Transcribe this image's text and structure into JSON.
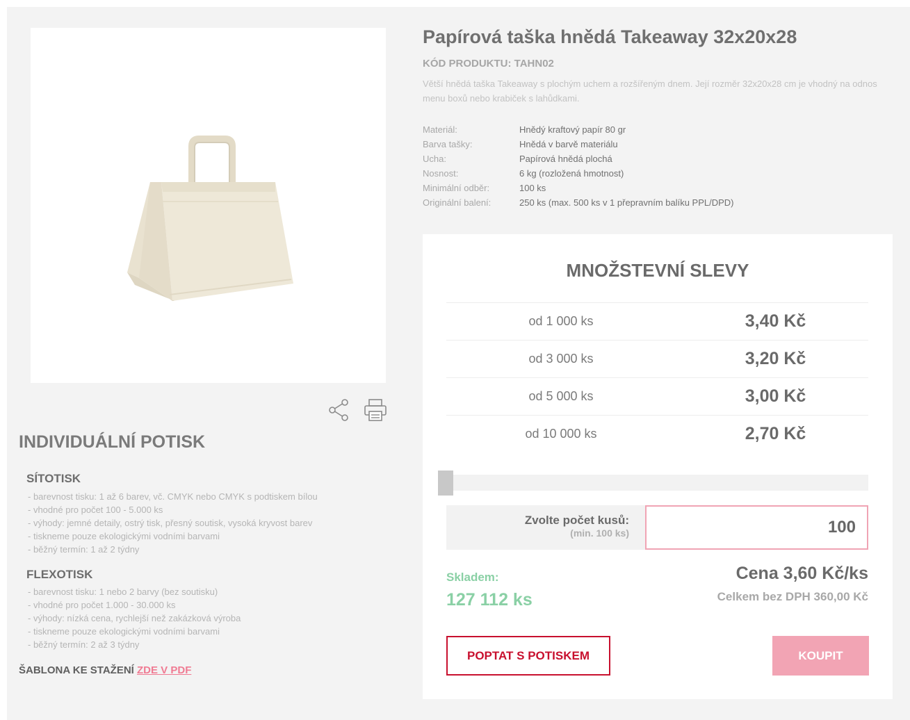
{
  "product": {
    "title": "Papírová taška hnědá Takeaway 32x20x28",
    "code": "KÓD PRODUKTU: TAHN02",
    "description": "Větší hnědá taška Takeaway s plochým uchem a rozšířeným dnem. Její rozměr 32x20x28 cm je vhodný na odnos menu boxů nebo krabiček s lahůdkami.",
    "specs": [
      {
        "label": "Materiál:",
        "value": "Hnědý kraftový papír 80 gr"
      },
      {
        "label": "Barva tašky:",
        "value": "Hnědá v barvě materiálu"
      },
      {
        "label": "Ucha:",
        "value": "Papírová hnědá plochá"
      },
      {
        "label": "Nosnost:",
        "value": "6 kg (rozložená hmotnost)"
      },
      {
        "label": "Minimální odběr:",
        "value": "100 ks"
      },
      {
        "label": "Originální balení:",
        "value": "250 ks (max. 500 ks v 1 přepravním balíku PPL/DPD)"
      }
    ]
  },
  "tools": {
    "share_icon": "share-icon",
    "print_icon": "printer-icon"
  },
  "print_section": {
    "title": "INDIVIDUÁLNÍ POTISK",
    "methods": [
      {
        "name": "SÍTOTISK",
        "items": [
          "barevnost tisku: 1 až 6 barev, vč. CMYK nebo CMYK s podtiskem bílou",
          "vhodné pro počet 100 - 5.000 ks",
          "výhody: jemné detaily, ostrý tisk, přesný soutisk, vysoká kryvost barev",
          "tiskneme pouze ekologickými vodními barvami",
          "běžný termín: 1 až 2 týdny"
        ]
      },
      {
        "name": "FLEXOTISK",
        "items": [
          "barevnost tisku: 1 nebo 2 barvy (bez soutisku)",
          "vhodné pro počet 1.000 - 30.000 ks",
          "výhody: nízká cena, rychlejší než zakázková výroba",
          "tiskneme pouze ekologickými vodními barvami",
          "běžný termín: 2 až 3 týdny"
        ]
      }
    ],
    "template_label": "ŠABLONA KE STAŽENÍ",
    "template_link": "ZDE V PDF"
  },
  "discounts": {
    "title": "MNOŽSTEVNÍ SLEVY",
    "tiers": [
      {
        "qty": "od 1 000 ks",
        "price": "3,40 Kč"
      },
      {
        "qty": "od 3 000 ks",
        "price": "3,20 Kč"
      },
      {
        "qty": "od 5 000 ks",
        "price": "3,00 Kč"
      },
      {
        "qty": "od 10 000 ks",
        "price": "2,70 Kč"
      }
    ],
    "slider_level": 0
  },
  "order": {
    "qty_label": "Zvolte počet kusů:",
    "qty_min": "(min. 100 ks)",
    "qty_value": "100",
    "stock_label": "Skladem:",
    "stock_value": "127 112 ks",
    "unit_price": "Cena 3,60 Kč/ks",
    "total": "Celkem bez DPH 360,00 Kč",
    "inquire_button": "POPTAT S POTISKEM",
    "buy_button": "KOUPIT"
  },
  "colors": {
    "accent_pink": "#f2a4b4",
    "accent_red": "#c8102e",
    "stock_green": "#8ad0a5",
    "link_pink": "#f07b93"
  }
}
